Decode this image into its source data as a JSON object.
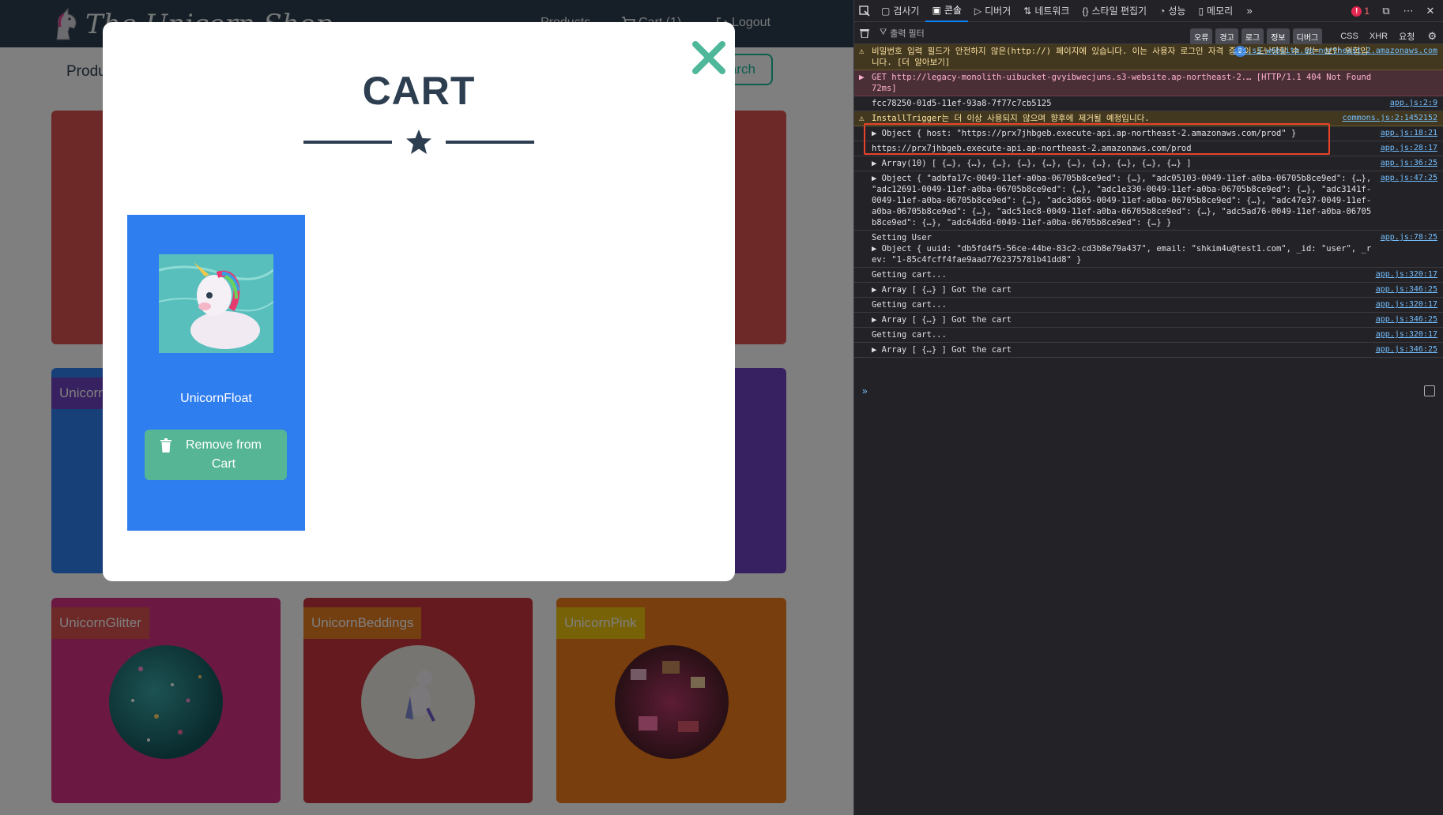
{
  "site": {
    "brand_text": "The Unicorn Shop",
    "nav": {
      "products": "Products",
      "cart": "Cart (1)",
      "logout": "Logout"
    },
    "subbar_title": "Products",
    "search_label": "Search"
  },
  "cards": [
    {
      "name": "UnicornGlitter",
      "color": "#d63384",
      "tag_color": "#d9534f"
    },
    {
      "name": "UnicornBeddings",
      "color": "#c9343c",
      "tag_color": "#e67e22"
    },
    {
      "name": "UnicornPink",
      "color": "#f27d1a",
      "tag_color": "#f1c40f"
    },
    {
      "name": "Unicorn",
      "color": "#2f7ef0",
      "tag_color": "#6f42c1"
    }
  ],
  "modal": {
    "title": "CART",
    "close_icon": "close-icon",
    "item": {
      "name": "UnicornFloat",
      "remove_label": "Remove from Cart",
      "remove_icon": "trash-icon"
    }
  },
  "devtools": {
    "tabs": [
      "검사기",
      "콘솔",
      "디버거",
      "네트워크",
      "스타일 편집기",
      "성능",
      "메모리"
    ],
    "active_tab": "콘솔",
    "error_count": "1",
    "filter_placeholder": "출력 필터",
    "filter_chips": [
      "오류",
      "경고",
      "로그",
      "정보",
      "디버그"
    ],
    "filter_plain": [
      "CSS",
      "XHR",
      "요청"
    ],
    "messages": [
      {
        "type": "warn",
        "text": "비밀번호 입력 필드가 안전하지 않은(http://) 페이지에 있습니다. 이는 사용자 로그인 자격 증명이 도난당할 수 있는 보안 위험입니다. [더 알아보기]",
        "badge": "2",
        "source": "…ns.s3-website.ap-northeast-2.amazonaws.com"
      },
      {
        "type": "err",
        "text": "GET http://legacy-monolith-uibucket-gvyibwecjuns.s3-website.ap-northeast-2.… [HTTP/1.1 404 Not Found 72ms]",
        "source": ""
      },
      {
        "type": "log",
        "text": "fcc78250-01d5-11ef-93a8-7f77c7cb5125",
        "source": "app.js:2:9"
      },
      {
        "type": "warn",
        "text": "InstallTrigger는 더 이상 사용되지 않으며 향후에 제거될 예정입니다.",
        "source": "commons.js:2:1452152"
      },
      {
        "type": "log",
        "text": "▶ Object { host: \"https://prx7jhbgeb.execute-api.ap-northeast-2.amazonaws.com/prod\" }",
        "source": "app.js:18:21"
      },
      {
        "type": "log",
        "text": "https://prx7jhbgeb.execute-api.ap-northeast-2.amazonaws.com/prod",
        "source": "app.js:28:17"
      },
      {
        "type": "log",
        "text": "▶ Array(10) [ {…}, {…}, {…}, {…}, {…}, {…}, {…}, {…}, {…}, {…} ]",
        "source": "app.js:36:25"
      },
      {
        "type": "log",
        "text": "▶ Object { \"adbfa17c-0049-11ef-a0ba-06705b8ce9ed\": {…}, \"adc05103-0049-11ef-a0ba-06705b8ce9ed\": {…}, \"adc12691-0049-11ef-a0ba-06705b8ce9ed\": {…}, \"adc1e330-0049-11ef-a0ba-06705b8ce9ed\": {…}, \"adc3141f-0049-11ef-a0ba-06705b8ce9ed\": {…}, \"adc3d865-0049-11ef-a0ba-06705b8ce9ed\": {…}, \"adc47e37-0049-11ef-a0ba-06705b8ce9ed\": {…}, \"adc51ec8-0049-11ef-a0ba-06705b8ce9ed\": {…}, \"adc5ad76-0049-11ef-a0ba-06705b8ce9ed\": {…}, \"adc64d6d-0049-11ef-a0ba-06705b8ce9ed\": {…} }",
        "source": "app.js:47:25"
      },
      {
        "type": "log",
        "text": "Setting User\n▶ Object { uuid: \"db5fd4f5-56ce-44be-83c2-cd3b8e79a437\", email: \"shkim4u@test1.com\", _id: \"user\", _rev: \"1-85c4fcff4fae9aad7762375781b41dd8\" }",
        "source": "app.js:78:25"
      },
      {
        "type": "log",
        "text": "Getting cart...",
        "source": "app.js:320:17"
      },
      {
        "type": "log",
        "text": "▶ Array [ {…} ] Got the cart",
        "source": "app.js:346:25"
      },
      {
        "type": "log",
        "text": "Getting cart...",
        "source": "app.js:320:17"
      },
      {
        "type": "log",
        "text": "▶ Array [ {…} ] Got the cart",
        "source": "app.js:346:25"
      },
      {
        "type": "log",
        "text": "Getting cart...",
        "source": "app.js:320:17"
      },
      {
        "type": "log",
        "text": "▶ Array [ {…} ] Got the cart",
        "source": "app.js:346:25"
      }
    ],
    "prompt": "»"
  }
}
